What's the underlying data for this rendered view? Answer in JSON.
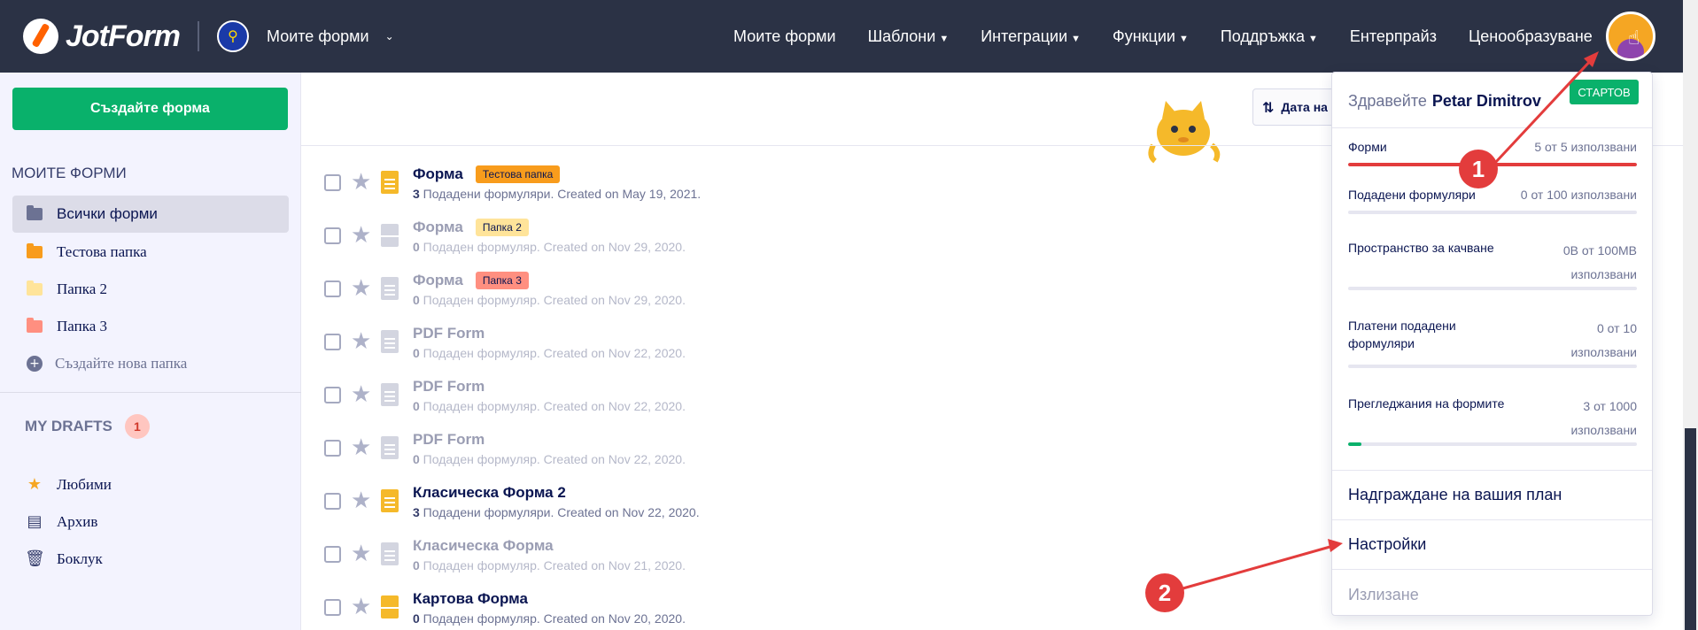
{
  "header": {
    "logo_text": "JotForm",
    "myforms_switch": "Моите форми",
    "nav": [
      {
        "label": "Моите форми",
        "caret": false
      },
      {
        "label": "Шаблони",
        "caret": true
      },
      {
        "label": "Интеграции",
        "caret": true
      },
      {
        "label": "Функции",
        "caret": true
      },
      {
        "label": "Поддръжка",
        "caret": true
      },
      {
        "label": "Ентерпрайз",
        "caret": false
      },
      {
        "label": "Ценообразуване",
        "caret": false
      }
    ]
  },
  "sidebar": {
    "create_button": "Създайте форма",
    "heading": "МОИТЕ ФОРМИ",
    "folders": [
      {
        "label": "Всички форми",
        "color": "#6c7293"
      },
      {
        "label": "Тестова папка",
        "color": "#f89c1c"
      },
      {
        "label": "Папка 2",
        "color": "#ffe49a"
      },
      {
        "label": "Папка 3",
        "color": "#ff8f80"
      }
    ],
    "new_folder": "Създайте нова папка",
    "drafts_label": "MY DRAFTS",
    "drafts_count": "1",
    "links": [
      {
        "label": "Любими",
        "icon": "star-icon"
      },
      {
        "label": "Архив",
        "icon": "archive-icon"
      },
      {
        "label": "Боклук",
        "icon": "trash-icon"
      }
    ]
  },
  "toolbar": {
    "sort_label": "Дата на"
  },
  "forms": [
    {
      "title": "Форма",
      "tag": "Тестова папка",
      "tag_color": "#f89c1c",
      "count": "3",
      "meta": " Подадени формуляри. Created on May 19, 2021.",
      "active": true,
      "icon": "list"
    },
    {
      "title": "Форма",
      "tag": "Папка 2",
      "tag_color": "#ffe49a",
      "count": "0",
      "meta": " Подаден формуляр. Created on Nov 29, 2020.",
      "active": false,
      "icon": "card"
    },
    {
      "title": "Форма",
      "tag": "Папка 3",
      "tag_color": "#ff8f80",
      "count": "0",
      "meta": " Подаден формуляр. Created on Nov 29, 2020.",
      "active": false,
      "icon": "list"
    },
    {
      "title": "PDF Form",
      "tag": "",
      "tag_color": "",
      "count": "0",
      "meta": " Подаден формуляр. Created on Nov 22, 2020.",
      "active": false,
      "icon": "list"
    },
    {
      "title": "PDF Form",
      "tag": "",
      "tag_color": "",
      "count": "0",
      "meta": " Подаден формуляр. Created on Nov 22, 2020.",
      "active": false,
      "icon": "list"
    },
    {
      "title": "PDF Form",
      "tag": "",
      "tag_color": "",
      "count": "0",
      "meta": " Подаден формуляр. Created on Nov 22, 2020.",
      "active": false,
      "icon": "list"
    },
    {
      "title": "Класическа Форма 2",
      "tag": "",
      "tag_color": "",
      "count": "3",
      "meta": " Подадени формуляри. Created on Nov 22, 2020.",
      "active": true,
      "icon": "list"
    },
    {
      "title": "Класическа Форма",
      "tag": "",
      "tag_color": "",
      "count": "0",
      "meta": " Подаден формуляр. Created on Nov 21, 2020.",
      "active": false,
      "icon": "list"
    },
    {
      "title": "Картова Форма",
      "tag": "",
      "tag_color": "",
      "count": "0",
      "meta": " Подаден формуляр. Created on Nov 20, 2020.",
      "active": true,
      "icon": "card"
    }
  ],
  "dropdown": {
    "greeting": "Здравейте",
    "user_name": "Petar Dimitrov",
    "plan": "СТАРТОВ",
    "usage": [
      {
        "label": "Форми",
        "value": "5 от 5 използвани",
        "fraction": 1.0,
        "color": "#e33c3c"
      },
      {
        "label": "Подадени формуляри",
        "value": "0 от 100 използвани",
        "fraction": 0.0,
        "color": "#09b16b"
      },
      {
        "label": "Пространство за качване",
        "value": "0B от 100MB използвани",
        "fraction": 0.0,
        "color": "#09b16b"
      },
      {
        "label": "Платени подадени формуляри",
        "value": "0 от 10 използвани",
        "fraction": 0.0,
        "color": "#09b16b"
      },
      {
        "label": "Прегледжания на формите",
        "value": "3 от 1000 използвани",
        "fraction": 0.003,
        "color": "#09b16b"
      }
    ],
    "upgrade": "Надграждане на вашия план",
    "settings": "Настройки",
    "logout": "Излизане"
  },
  "annotations": {
    "marker_1": "1",
    "marker_2": "2",
    "arrow_color": "#e33c3c"
  }
}
